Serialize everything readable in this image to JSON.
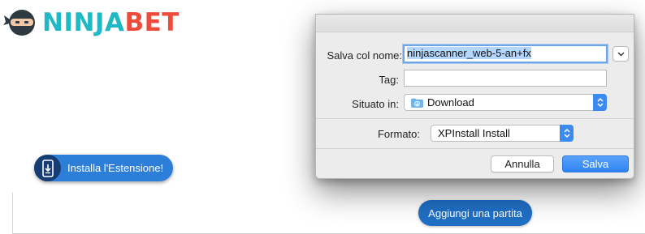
{
  "logo": {
    "part1": "NINJA",
    "part2": "BET",
    "color1": "#20b8c4",
    "color2": "#ee4b3a"
  },
  "install_button": {
    "label": "Installa l'Estensione!",
    "icon": "download-phone-icon"
  },
  "add_match_button": {
    "label": "Aggiungi una partita"
  },
  "dialog": {
    "save_as_label": "Salva col nome:",
    "save_as_value": "ninjascanner_web-5-an+fx",
    "tag_label": "Tag:",
    "tag_value": "",
    "location_label": "Situato in:",
    "location_value": "Download",
    "location_icon": "download-folder-icon",
    "format_label": "Formato:",
    "format_value": "XPInstall Install",
    "expand_icon": "chevron-down-icon",
    "cancel_label": "Annulla",
    "save_label": "Salva",
    "accent_color": "#3a8af0"
  }
}
